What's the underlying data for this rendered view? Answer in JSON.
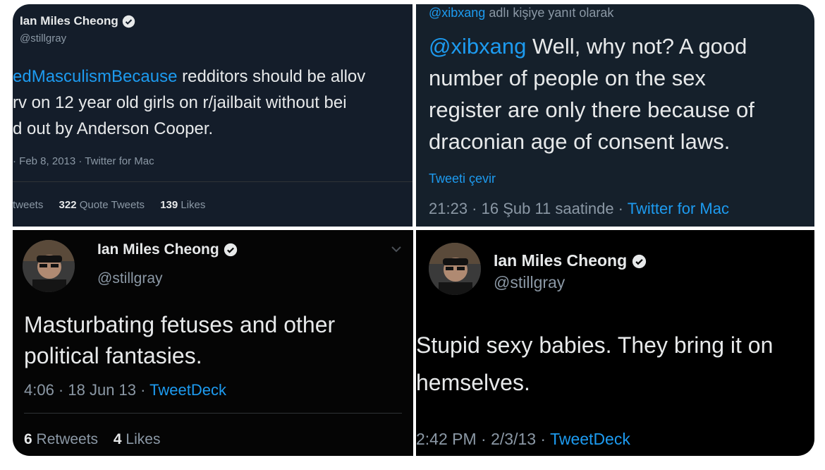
{
  "panel1": {
    "name": "Ian Miles Cheong",
    "handle": "@stillgray",
    "text_line1_link": "edMasculismBecause",
    "text_line1_rest": " redditors should be allov",
    "text_line2": "rv on 12 year old girls on r/jailbait without bei",
    "text_line3": "d out by Anderson Cooper.",
    "meta": "· Feb 8, 2013 · Twitter for Mac",
    "stats_retweets_label": "tweets",
    "stats_quote_count": "322",
    "stats_quote_label": " Quote Tweets",
    "stats_likes_count": "139",
    "stats_likes_label": " Likes"
  },
  "panel2": {
    "reply_handle": "@xibxang",
    "reply_rest": " adlı kişiye yanıt olarak",
    "text_mention": "@xibxang",
    "text_line1_rest": " Well, why not? A good",
    "text_line2": "number of people on the sex",
    "text_line3": "register are only there because of",
    "text_line4": "draconian age of consent laws.",
    "translate": "Tweeti çevir",
    "meta_time": "21:23 · 16 Şub 11 saatinde · ",
    "meta_source": "Twitter for Mac"
  },
  "panel3": {
    "name": "Ian Miles Cheong",
    "handle": "@stillgray",
    "text_line1": "Masturbating fetuses and other",
    "text_line2": "political fantasies.",
    "meta_time": "4:06 · 18 Jun 13 · ",
    "meta_source": "TweetDeck",
    "retweets_count": "6",
    "retweets_label": " Retweets",
    "likes_count": "4",
    "likes_label": " Likes"
  },
  "panel4": {
    "name": "Ian Miles Cheong",
    "handle": "@stillgray",
    "text_line1": "Stupid sexy babies. They bring it on",
    "text_line2": "hemselves.",
    "meta_time": "2:42 PM · 2/3/13 · ",
    "meta_source": "TweetDeck"
  },
  "colors": {
    "link": "#1d9bf0",
    "muted": "#8b98a5",
    "text": "#e7e9ea"
  }
}
